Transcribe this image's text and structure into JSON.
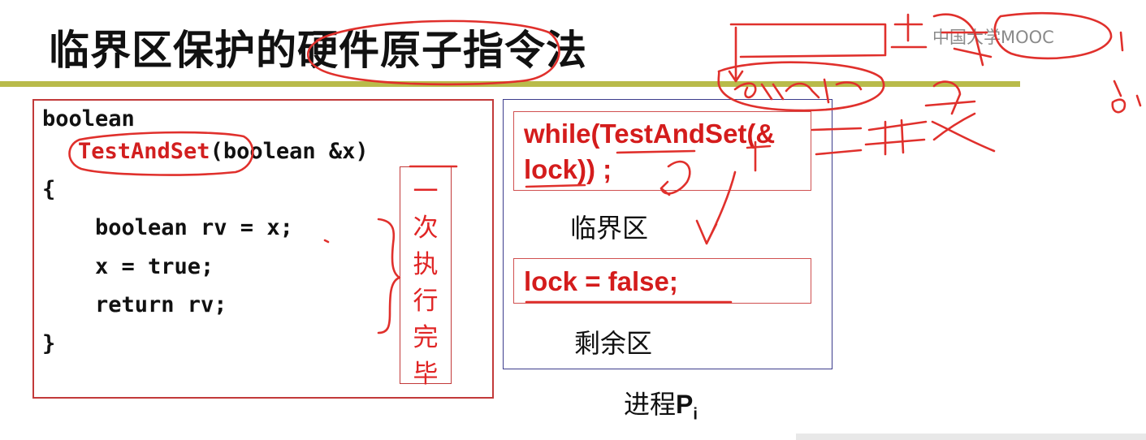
{
  "slide": {
    "title": "临界区保护的硬件原子指令法"
  },
  "code": {
    "line1": "boolean",
    "fn_name": "TestAndSet",
    "fn_params": "(boolean &x)",
    "open_brace": "{",
    "body": [
      "boolean rv = x;",
      "x = true;",
      "return rv;"
    ],
    "close_brace": "}",
    "atomic_note": [
      "一",
      "次",
      "执",
      "行",
      "完",
      "毕"
    ]
  },
  "process": {
    "entry_line1": "while(TestAndSet(&",
    "entry_line2": "lock)) ;",
    "critical_label": "临界区",
    "exit_code": "lock = false;",
    "remainder_label": "剩余区",
    "caption_prefix": "进程",
    "caption_var": "P",
    "caption_sub": "i"
  },
  "watermark": {
    "text": "中国大学MOOC"
  },
  "colors": {
    "accent_red": "#d41c1c",
    "rule_olive": "#b9bb4a",
    "process_border": "#3c3c8c"
  }
}
